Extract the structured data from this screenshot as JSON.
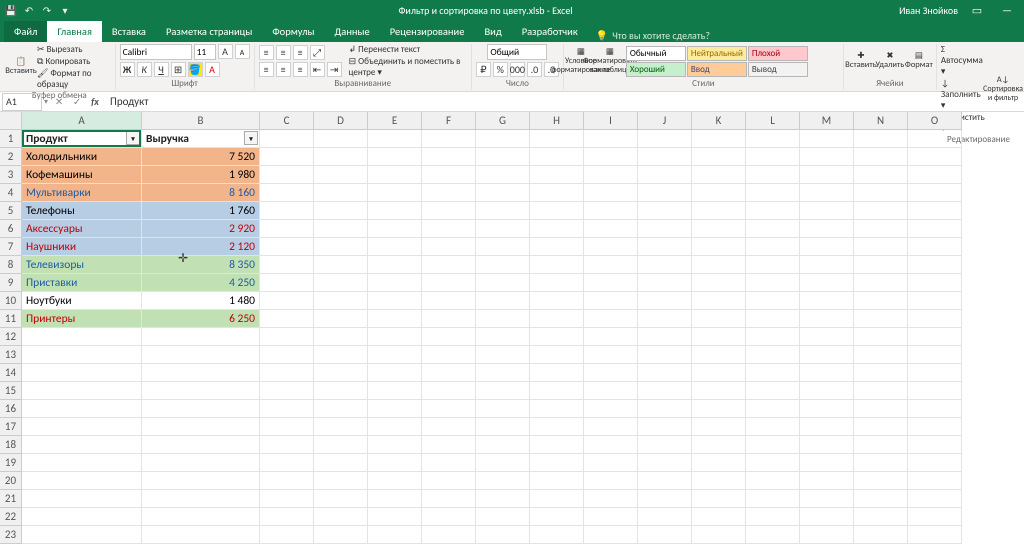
{
  "title": "Фильтр и сортировка по цвету.xlsb - Excel",
  "user": "Иван Знойков",
  "tabs": {
    "file": "Файл",
    "home": "Главная",
    "insert": "Вставка",
    "layout": "Разметка страницы",
    "formulas": "Формулы",
    "data": "Данные",
    "review": "Рецензирование",
    "view": "Вид",
    "developer": "Разработчик",
    "tellme": "Что вы хотите сделать?"
  },
  "ribbon": {
    "clipboard": {
      "paste": "Вставить",
      "cut": "Вырезать",
      "copy": "Копировать",
      "formatPainter": "Формат по образцу",
      "label": "Буфер обмена"
    },
    "font": {
      "name": "Calibri",
      "size": "11",
      "label": "Шрифт"
    },
    "align": {
      "wrap": "Перенести текст",
      "merge": "Объединить и поместить в центре",
      "label": "Выравнивание"
    },
    "number": {
      "format": "Общий",
      "label": "Число"
    },
    "styles": {
      "cond": "Условное форматирование",
      "table": "Форматировать как таблицу",
      "label": "Стили",
      "cells": [
        {
          "t": "Обычный",
          "bg": "#ffffff",
          "c": "#000"
        },
        {
          "t": "Нейтральный",
          "bg": "#ffeb9c",
          "c": "#9c6500"
        },
        {
          "t": "Плохой",
          "bg": "#ffc7ce",
          "c": "#9c0006"
        },
        {
          "t": "Хороший",
          "bg": "#c6efce",
          "c": "#006100"
        },
        {
          "t": "Ввод",
          "bg": "#ffcc99",
          "c": "#3f3f76"
        },
        {
          "t": "Вывод",
          "bg": "#f2f2f2",
          "c": "#3f3f3f"
        }
      ]
    },
    "cells": {
      "insert": "Вставить",
      "delete": "Удалить",
      "format": "Формат",
      "label": "Ячейки"
    },
    "editing": {
      "sum": "Автосумма",
      "fill": "Заполнить",
      "clear": "Очистить",
      "sort": "Сортировка и фильтр",
      "label": "Редактирование"
    }
  },
  "nameBox": "A1",
  "formulaBar": "Продукт",
  "columns": [
    "A",
    "B",
    "C",
    "D",
    "E",
    "F",
    "G",
    "H",
    "I",
    "J",
    "K",
    "L",
    "M",
    "N",
    "O"
  ],
  "colWidths": {
    "A": 120,
    "B": 118,
    "default": 54
  },
  "headers": {
    "A": "Продукт",
    "B": "Выручка"
  },
  "rows": [
    {
      "p": "Холодильники",
      "v": "7 520",
      "bg": "#f2b48a",
      "c": "#000"
    },
    {
      "p": "Кофемашины",
      "v": "1 980",
      "bg": "#f2b48a",
      "c": "#000"
    },
    {
      "p": "Мультиварки",
      "v": "8 160",
      "bg": "#f2b48a",
      "c": "#1f5ba3",
      "vc": "#1f5ba3"
    },
    {
      "p": "Телефоны",
      "v": "1 760",
      "bg": "#b7cde4",
      "c": "#000"
    },
    {
      "p": "Аксессуары",
      "v": "2 920",
      "bg": "#b7cde4",
      "c": "#c00000",
      "vc": "#c00000"
    },
    {
      "p": "Наушники",
      "v": "2 120",
      "bg": "#b7cde4",
      "c": "#c00000",
      "vc": "#c00000"
    },
    {
      "p": "Телевизоры",
      "v": "8 350",
      "bg": "#c1e1b4",
      "c": "#1f5ba3",
      "vc": "#1f5ba3"
    },
    {
      "p": "Приставки",
      "v": "4 250",
      "bg": "#c1e1b4",
      "c": "#1f5ba3",
      "vc": "#1f5ba3"
    },
    {
      "p": "Ноутбуки",
      "v": "1 480",
      "bg": "#ffffff",
      "c": "#000"
    },
    {
      "p": "Принтеры",
      "v": "6 250",
      "bg": "#c1e1b4",
      "c": "#c00000",
      "vc": "#c00000"
    }
  ],
  "rowCount": 23
}
